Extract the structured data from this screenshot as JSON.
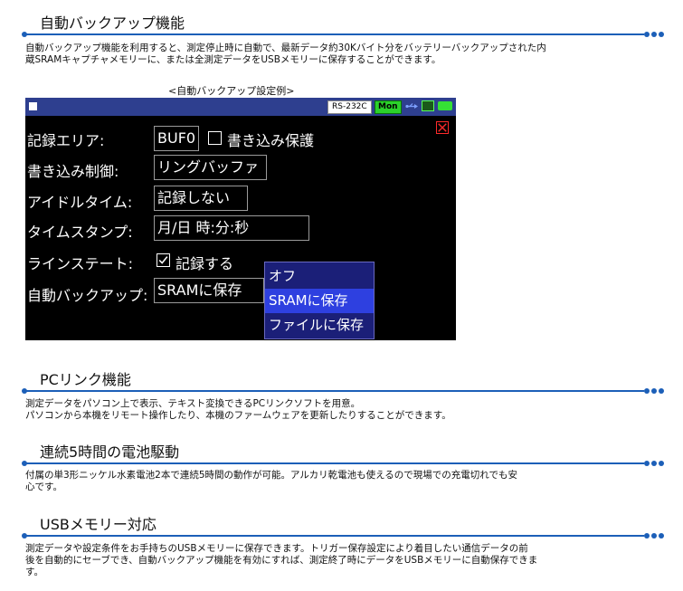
{
  "sections": [
    {
      "title": "自動バックアップ機能",
      "lines": [
        "自動バックアップ機能を利用すると、測定停止時に自動で、最新データ約30Kバイト分をバッテリーバックアップされた内",
        "蔵SRAMキャプチャメモリーに、または全測定データをUSBメモリーに保存することができます。"
      ]
    },
    {
      "title": "PCリンク機能",
      "lines": [
        "測定データをパソコン上で表示、テキスト変換できるPCリンクソフトを用意。",
        "パソコンから本機をリモート操作したり、本機のファームウェアを更新したりすることができます。"
      ]
    },
    {
      "title": "連続5時間の電池駆動",
      "lines": [
        "付属の単3形ニッケル水素電池2本で連続5時間の動作が可能。アルカリ乾電池も使えるので現場での充電切れでも安",
        "心です。"
      ]
    },
    {
      "title": "USBメモリー対応",
      "lines": [
        "測定データや設定条件をお手持ちのUSBメモリーに保存できます。トリガー保存設定により着目したい通信データの前",
        "後を自動的にセーブでき、自動バックアップ機能を有効にすれば、測定終了時にデータをUSBメモリーに自動保存できま",
        "す。"
      ]
    }
  ],
  "screenshot": {
    "caption": "<自動バックアップ設定例>",
    "status": {
      "port": "RS-232C",
      "mode": "Mon"
    },
    "rows": {
      "area": {
        "label": "記録エリア:",
        "value": "BUF0",
        "checkbox_label": "書き込み保護",
        "checked": false
      },
      "write_control": {
        "label": "書き込み制御:",
        "value": "リングバッファ"
      },
      "idle_time": {
        "label": "アイドルタイム:",
        "value": "記録しない"
      },
      "timestamp": {
        "label": "タイムスタンプ:",
        "value": "月/日 時:分:秒"
      },
      "line_state": {
        "label": "ラインステート:",
        "checkbox_label": "記録する",
        "checked": true
      },
      "auto_backup": {
        "label": "自動バックアップ:",
        "value": "SRAMに保存"
      }
    },
    "dropdown": {
      "options": [
        "オフ",
        "SRAMに保存",
        "ファイルに保存"
      ],
      "selected": "SRAMに保存"
    },
    "colors": {
      "accent": "#1c5fb8",
      "status_bar": "#2e3f8f",
      "mon_badge": "#2bd12b",
      "dropdown_bg": "#1b1f78",
      "dropdown_selected": "#2e40e0",
      "close": "#ff2a2a"
    },
    "icons": [
      "usb-icon",
      "card-icon",
      "battery-icon",
      "close-icon",
      "checkbox-icon",
      "checkmark-icon"
    ]
  }
}
